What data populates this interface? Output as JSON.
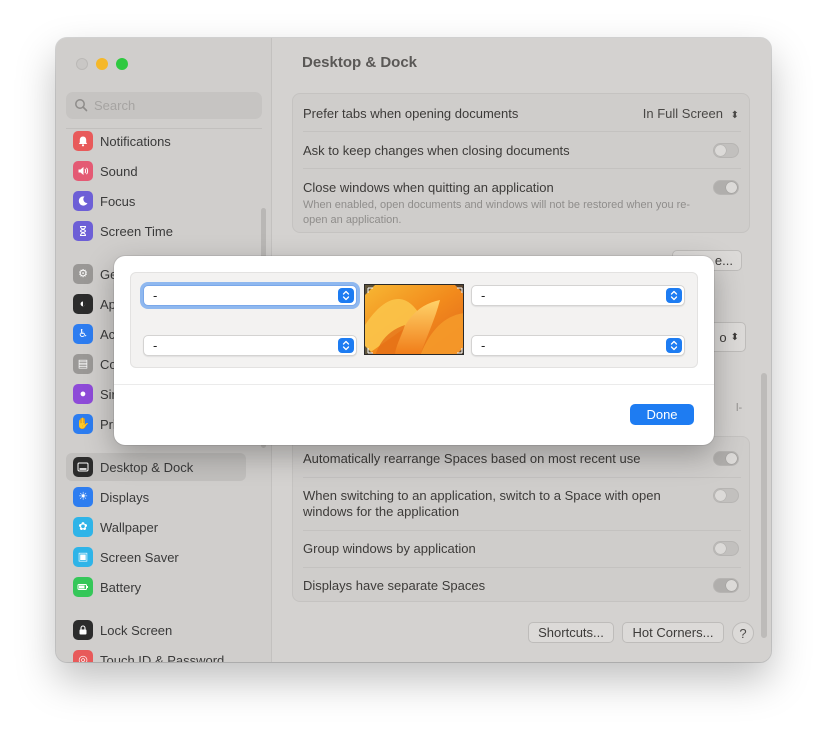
{
  "window": {
    "title": "Desktop & Dock"
  },
  "sidebar": {
    "search_placeholder": "Search",
    "items_top": [
      {
        "label": "Notifications",
        "icon": "bell-icon",
        "color": "#e85a5a"
      },
      {
        "label": "Sound",
        "icon": "speaker-icon",
        "color": "#e45a74"
      },
      {
        "label": "Focus",
        "icon": "moon-icon",
        "color": "#6d5fd6"
      },
      {
        "label": "Screen Time",
        "icon": "hourglass-icon",
        "color": "#6d5fd6"
      }
    ],
    "items_mid": [
      {
        "label": "Ge",
        "icon": "gear-icon",
        "color": "#9a9896"
      },
      {
        "label": "Ap",
        "icon": "appearance-icon",
        "color": "#2c2c2c"
      },
      {
        "label": "Ac",
        "icon": "accessibility-icon",
        "color": "#2d7df0"
      },
      {
        "label": "Co",
        "icon": "control-center-icon",
        "color": "#9a9896"
      },
      {
        "label": "Sir",
        "icon": "siri-icon",
        "color": "#8e4bd8"
      },
      {
        "label": "Pri",
        "icon": "hand-icon",
        "color": "#2d7df0"
      }
    ],
    "items_bottom": [
      {
        "label": "Desktop & Dock",
        "icon": "dock-icon",
        "color": "#2c2c2c"
      },
      {
        "label": "Displays",
        "icon": "sun-icon",
        "color": "#2d7df0"
      },
      {
        "label": "Wallpaper",
        "icon": "flower-icon",
        "color": "#2fb4e8"
      },
      {
        "label": "Screen Saver",
        "icon": "screen-saver-icon",
        "color": "#2fb4e8"
      },
      {
        "label": "Battery",
        "icon": "battery-icon",
        "color": "#35c759"
      }
    ],
    "items_last": [
      {
        "label": "Lock Screen",
        "icon": "lock-icon",
        "color": "#2c2c2c"
      },
      {
        "label": "Touch ID & Password",
        "icon": "fingerprint-icon",
        "color": "#e85a5a"
      }
    ]
  },
  "main": {
    "windows_card": {
      "prefer_tabs_label": "Prefer tabs when opening documents",
      "prefer_tabs_value": "In Full Screen",
      "ask_keep_label": "Ask to keep changes when closing documents",
      "ask_keep_on": false,
      "close_windows_label": "Close windows when quitting an application",
      "close_windows_sub": "When enabled, open documents and windows will not be restored when you re-open an application.",
      "close_windows_on": true
    },
    "partial_button_label": "e...",
    "partial_popup_label": "o",
    "partial_text": "l-",
    "spaces_card": {
      "rearrange_label": "Automatically rearrange Spaces based on most recent use",
      "rearrange_on": true,
      "switch_label": "When switching to an application, switch to a Space with open windows for the application",
      "switch_on": false,
      "group_label": "Group windows by application",
      "group_on": false,
      "separate_label": "Displays have separate Spaces",
      "separate_on": true
    },
    "shortcuts_label": "Shortcuts...",
    "hot_corners_label": "Hot Corners...",
    "help_label": "?"
  },
  "sheet": {
    "top_left_value": "-",
    "top_right_value": "-",
    "bottom_left_value": "-",
    "bottom_right_value": "-",
    "done_label": "Done"
  }
}
